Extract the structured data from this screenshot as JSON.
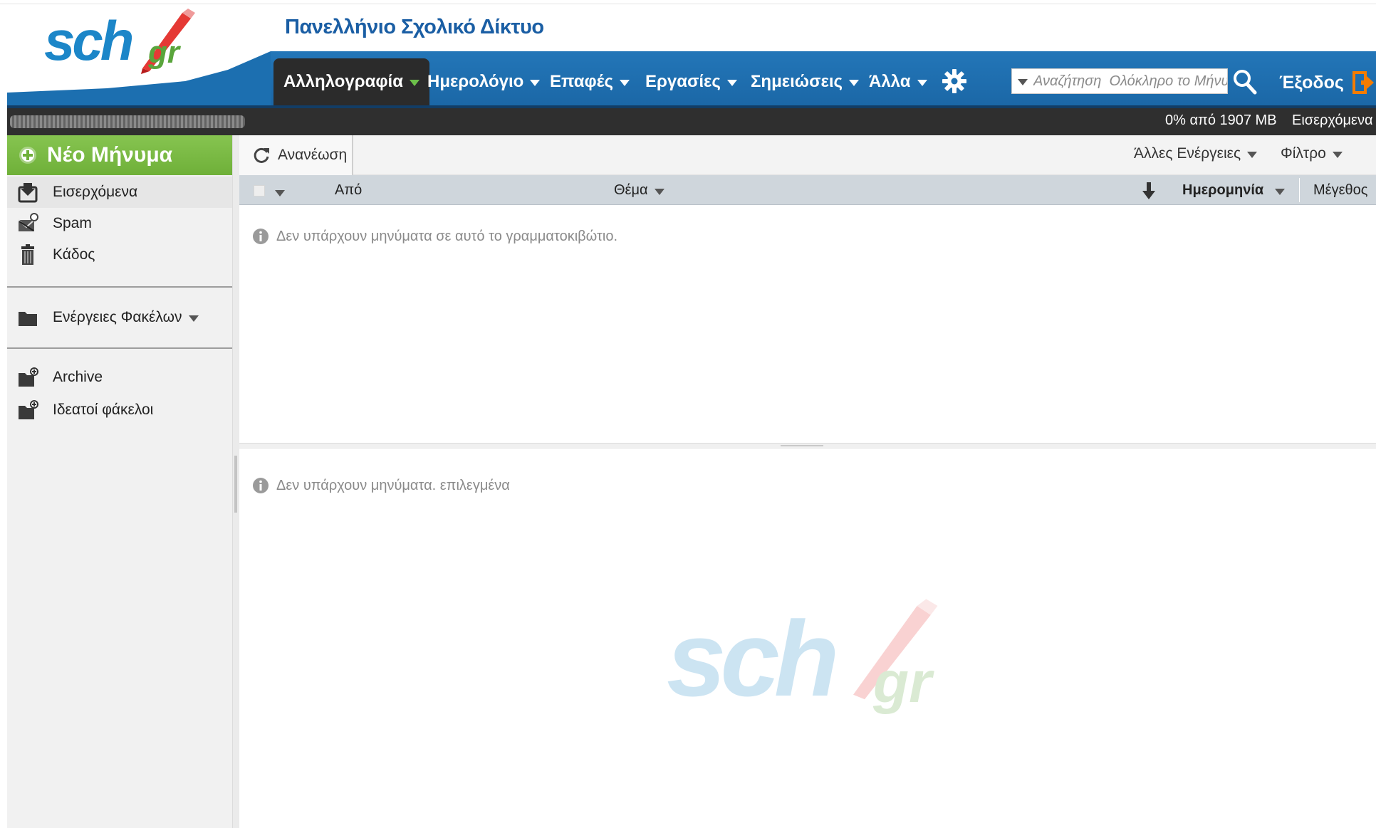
{
  "header": {
    "logo_main": "sch",
    "logo_suffix": "gr",
    "site_title": "Πανελλήνιο Σχολικό Δίκτυο"
  },
  "nav": {
    "items": [
      {
        "label": "Αλληλογραφία",
        "active": true
      },
      {
        "label": "Ημερολόγιο"
      },
      {
        "label": "Επαφές"
      },
      {
        "label": "Εργασίες"
      },
      {
        "label": "Σημειώσεις"
      },
      {
        "label": "Άλλα"
      }
    ],
    "settings_icon": "gear-icon",
    "search_placeholder": "Αναζήτηση  Ολόκληρο το Μήνυμ",
    "logout_label": "Έξοδος"
  },
  "status": {
    "quota": "0% από 1907 MB",
    "current_folder": "Εισερχόμενα"
  },
  "sidebar": {
    "new_message_label": "Νέο Μήνυμα",
    "folders": [
      {
        "label": "Εισερχόμενα",
        "icon": "inbox-icon",
        "selected": true
      },
      {
        "label": "Spam",
        "icon": "spam-icon"
      },
      {
        "label": "Κάδος",
        "icon": "trash-icon"
      }
    ],
    "folder_actions_label": "Ενέργειες Φακέλων",
    "other_folders": [
      {
        "label": "Archive",
        "icon": "folder-add-icon"
      },
      {
        "label": "Ιδεατοί φάκελοι",
        "icon": "folder-add-icon"
      }
    ]
  },
  "toolbar": {
    "refresh_label": "Ανανέωση",
    "other_actions_label": "Άλλες Ενέργειες",
    "filter_label": "Φίλτρο"
  },
  "columns": {
    "from": "Από",
    "subject": "Θέμα",
    "date": "Ημερομηνία",
    "size": "Μέγεθος"
  },
  "messages": {
    "empty_list": "Δεν υπάρχουν μηνύματα σε αυτό το γραμματοκιβώτιο.",
    "empty_preview": "Δεν υπάρχουν μηνύματα. επιλεγμένα"
  },
  "colors": {
    "nav_blue": "#1c6fb0",
    "brand_green": "#6fb039",
    "brand_blue": "#1c86c8",
    "status_bar": "#2f2f2f"
  }
}
